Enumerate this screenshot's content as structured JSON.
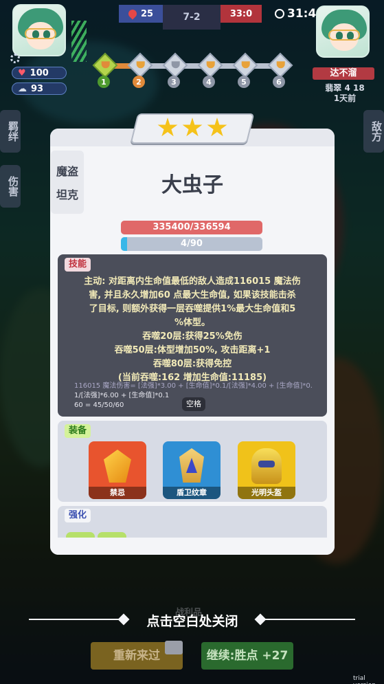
{
  "hud": {
    "player": {
      "hp": "100",
      "shield": "93"
    },
    "score": {
      "left": "25",
      "stage": "7-2",
      "right": "33:0"
    },
    "timer": "31:4",
    "stages": [
      "1",
      "2",
      "3",
      "4",
      "5",
      "6"
    ],
    "current_stage_progress": 0.2,
    "enemy": {
      "name": "达不溜",
      "sub_line1": "翡翠 4 18",
      "sub_line2": "1天前"
    },
    "side_tabs": {
      "bond": "羁绊",
      "damage": "伤害",
      "enemy": "敌方"
    }
  },
  "card": {
    "stars": 3,
    "tags": [
      "魔盗",
      "坦克"
    ],
    "name": "大虫子",
    "hp_text": "335400/336594",
    "hp_fraction": 0.996,
    "mp_text": "4/90",
    "mp_fraction": 0.044,
    "skill": {
      "label": "技能",
      "lines": [
        "主动: 对距离内生命值最低的敌人造成116015 魔法伤",
        "害, 并且永久增加60 点最大生命值, 如果该技能击杀",
        "了目标, 则额外获得一层吞噬提供1%最大生命值和5",
        "%体型。",
        "吞噬20层:获得25%免伤",
        "吞噬50层:体型增加50%, 攻击距离+1",
        "吞噬80层:获得免控",
        "(当前吞噬:162 增加生命值:11185)"
      ],
      "formula_line1": "116015 魔法伤害= [法强]*3.00 + [生命值]*0.1/[法强]*4.00 + [生命值]*0.",
      "formula_line2": "1/[法强]*6.00 + [生命值]*0.1",
      "formula_line3": "60 = 45/50/60",
      "space_key": "空格"
    },
    "equipment": {
      "label": "装备",
      "items": [
        {
          "name": "禁忌",
          "color": "#e8542e",
          "icon": "crystal-icon"
        },
        {
          "name": "盾卫纹章",
          "color": "#2f8fd4",
          "icon": "crest-icon"
        },
        {
          "name": "光明头盔",
          "color": "#f0c21a",
          "icon": "helmet-icon"
        }
      ]
    },
    "enhance": {
      "label": "强化"
    }
  },
  "footer": {
    "ghost": "战利品",
    "close_hint": "点击空白处关闭",
    "retry": "重新来过",
    "continue": "继续:胜点 +27",
    "watermark": "trial version"
  }
}
